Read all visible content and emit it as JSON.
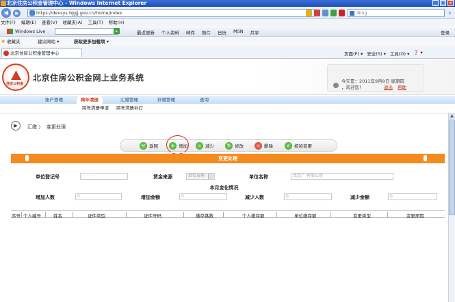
{
  "browser": {
    "title": "北京住房公积金管理中心 - Windows Internet Explorer",
    "url": "https://devsys.bjgjj.gov.cn/home/index",
    "search_placeholder": "Bing",
    "menus": [
      "文件(F)",
      "编辑(E)",
      "查看(V)",
      "收藏夹(A)",
      "工具(T)",
      "帮助(H)"
    ],
    "live_label": "Windows Live",
    "live_items": [
      "最近更新",
      "个人资料",
      "邮件",
      "照片",
      "日历",
      "MSN",
      "共享"
    ],
    "live_login": "登录",
    "favorites_label": "收藏夹",
    "favorites": [
      "建议网站 ▾",
      "获取更多加载项 ▾"
    ],
    "tab_title": "北京住房公积金管理中心",
    "commands": [
      "页面(P) ▾",
      "安全(S) ▾",
      "工具(O) ▾",
      "❓ ▾"
    ]
  },
  "header": {
    "site_title": "北京住房公积金网上业务系统",
    "logo_text": "住房公积金",
    "date_text": "今天是：2011年9月8日    星期四",
    "welcome_text": "，欢迎您！",
    "logout": "退出",
    "help": "帮助"
  },
  "nav": {
    "items": [
      "账户管理",
      "跨年清册",
      "汇缴管理",
      "补缴管理",
      "查询"
    ],
    "active_index": 1,
    "subitems": [
      "跨年清册申请",
      "跨年清册补打"
    ]
  },
  "breadcrumb": {
    "parent": "汇缴 〉",
    "current": "变更处理"
  },
  "toolbar": {
    "buttons": [
      "返回",
      "增加",
      "减少",
      "修改",
      "删除",
      "校验变更"
    ]
  },
  "panel": {
    "title": "变更处理"
  },
  "form": {
    "unit_code_label": "单位登记号",
    "unit_code_value": "·  ·  ·  ·  ·",
    "fund_source_label": "赁金来源",
    "fund_source_value": "单位自筹",
    "unit_name_label": "单位名称",
    "unit_name_value": "北京广        有限公司",
    "section_title": "本月变化情况",
    "add_count_label": "增加人数",
    "add_count_value": "0",
    "add_amount_label": "增加金额",
    "add_amount_value": "0",
    "reduce_count_label": "减少人数",
    "reduce_count_value": "0",
    "reduce_amount_label": "减少金额",
    "reduce_amount_value": "0"
  },
  "grid": {
    "columns": [
      "序号",
      "个人编号",
      "姓名",
      "证件类型",
      "证件号码",
      "缴存基数",
      "个人缴存额",
      "单位缴存额",
      "变更类型",
      "变更原因"
    ]
  },
  "colors": {
    "accent": "#f58a1f",
    "brand": "#d04020",
    "nav_text": "#2a4e80"
  }
}
